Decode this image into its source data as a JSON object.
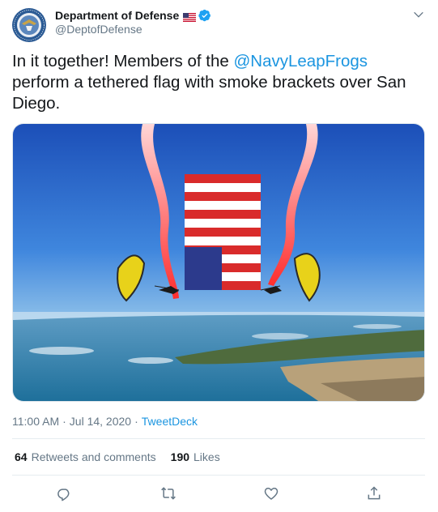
{
  "author": {
    "display_name": "Department of Defense",
    "handle": "@DeptofDefense",
    "avatar_icon": "dod-seal-icon",
    "flag_icon": "us-flag-emoji-icon",
    "verified_icon": "verified-badge-icon"
  },
  "tweet": {
    "text_before": "In it together! Members of the ",
    "mention": "@NavyLeapFrogs",
    "text_after": " perform a tethered flag with smoke brackets over San Diego.",
    "media_icon": "photo-parachute-flag"
  },
  "meta": {
    "time": "11:00 AM",
    "date": "Jul 14, 2020",
    "separator": "·",
    "source": "TweetDeck"
  },
  "stats": {
    "retweets_count": "64",
    "retweets_label": "Retweets and comments",
    "likes_count": "190",
    "likes_label": "Likes"
  },
  "actions": [
    "reply-icon",
    "retweet-icon",
    "like-icon",
    "share-icon"
  ],
  "colors": {
    "link": "#1b95e0",
    "secondary_text": "#657786",
    "primary_text": "#14171a",
    "divider": "#e6ecf0"
  }
}
